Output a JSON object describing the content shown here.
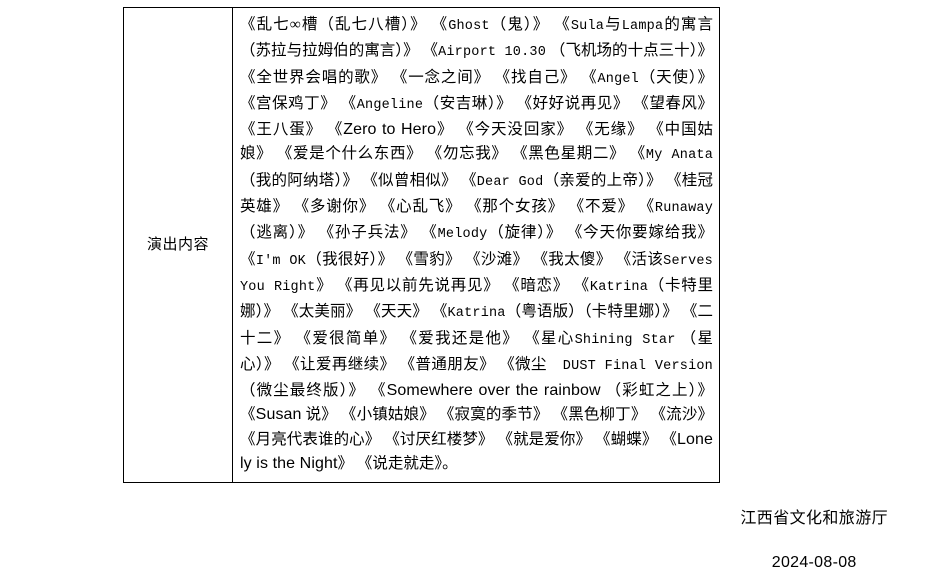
{
  "document": {
    "type": "government-notice-table-fragment"
  },
  "table": {
    "rows": [
      {
        "label": "演出内容",
        "segments": [
          {
            "style": "cjk",
            "text": "《乱七∞槽（乱七八槽）》 《"
          },
          {
            "style": "mono",
            "text": "Ghost"
          },
          {
            "style": "cjk",
            "text": "（鬼）》 《"
          },
          {
            "style": "mono",
            "text": "Sula"
          },
          {
            "style": "cjk",
            "text": "与"
          },
          {
            "style": "mono",
            "text": "Lampa"
          },
          {
            "style": "cjk",
            "text": "的寓言（苏拉与拉姆伯的寓言）》 《"
          },
          {
            "style": "mono",
            "text": "Airport 10.30"
          },
          {
            "style": "cjk",
            "text": " （飞机场的十点三十）》 《全世界会唱的歌》 《一念之间》 《找自己》 《"
          },
          {
            "style": "mono",
            "text": "Angel"
          },
          {
            "style": "cjk",
            "text": "（天使）》 《宫保鸡丁》 《"
          },
          {
            "style": "mono",
            "text": "Angeline"
          },
          {
            "style": "cjk",
            "text": "（安吉琳）》 《好好说再见》 《望春风》 《王八蛋》 《"
          },
          {
            "style": "sans",
            "text": "Zero to Hero"
          },
          {
            "style": "cjk",
            "text": "》 《今天没回家》 《无缘》 《中国姑娘》 《爱是个什么东西》 《勿忘我》 《黑色星期二》 《"
          },
          {
            "style": "mono",
            "text": "My Anata"
          },
          {
            "style": "cjk",
            "text": "（我的阿纳塔）》 《似曾相似》 《"
          },
          {
            "style": "mono",
            "text": "Dear God"
          },
          {
            "style": "cjk",
            "text": "（亲爱的上帝）》 《桂冠英雄》 《多谢你》 《心乱飞》 《那个女孩》 《不爱》 《"
          },
          {
            "style": "mono",
            "text": "Runaway"
          },
          {
            "style": "cjk",
            "text": "（逃离）》 《孙子兵法》 《"
          },
          {
            "style": "mono",
            "text": "Melody"
          },
          {
            "style": "cjk",
            "text": "（旋律）》 《今天你要嫁给我》 《"
          },
          {
            "style": "mono",
            "text": "I'm OK"
          },
          {
            "style": "cjk",
            "text": "（我很好）》 《雪豹》 《沙滩》 《我太傻》 《活该"
          },
          {
            "style": "mono",
            "text": "Serves You Right"
          },
          {
            "style": "cjk",
            "text": "》 《再见以前先说再见》 《暗恋》 《"
          },
          {
            "style": "mono",
            "text": "Katrina"
          },
          {
            "style": "cjk",
            "text": "（卡特里娜）》 《太美丽》 《天天》 《"
          },
          {
            "style": "mono",
            "text": "Katrina"
          },
          {
            "style": "cjk",
            "text": "（粤语版）（卡特里娜）》 《二十二》 《爱很简单》 《爱我还是他》 《星心"
          },
          {
            "style": "mono",
            "text": "Shining Star"
          },
          {
            "style": "cjk",
            "text": " （星心）》 《让爱再继续》 《普通朋友》 《微尘　"
          },
          {
            "style": "mono",
            "text": "DUST Final Version"
          },
          {
            "style": "cjk",
            "text": "（微尘最终版）》 《"
          },
          {
            "style": "sans",
            "text": "Somewhere over the rainbow"
          },
          {
            "style": "cjk",
            "text": " （彩虹之上）》 《"
          },
          {
            "style": "sans",
            "text": "Susan"
          },
          {
            "style": "cjk",
            "text": " 说》 《小镇姑娘》 《寂寞的季节》 《黑色柳丁》 《流沙》 《月亮代表谁的心》 《讨厌红楼梦》 《就是爱你》 《蝴蝶》 《"
          },
          {
            "style": "sans",
            "text": "Lonely is the Night"
          },
          {
            "style": "cjk",
            "text": "》 《说走就走》。"
          }
        ]
      }
    ]
  },
  "signature": {
    "organization": "江西省文化和旅游厅",
    "date": "2024-08-08"
  }
}
